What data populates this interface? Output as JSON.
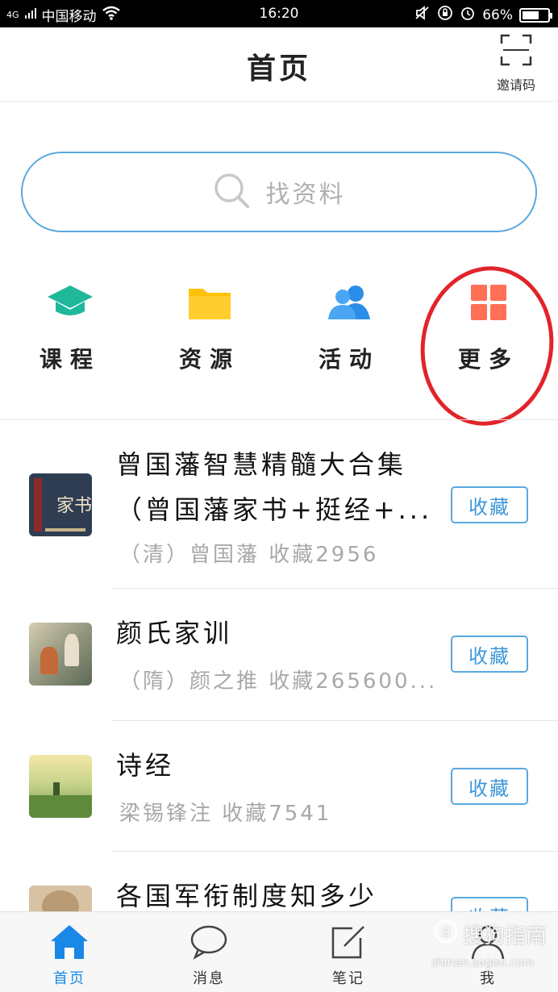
{
  "status_bar": {
    "network": "4G",
    "carrier": "中国移动",
    "time": "16:20",
    "battery": "66%",
    "battery_level": 0.66
  },
  "header": {
    "title": "首页",
    "invite_label": "邀请码"
  },
  "search": {
    "placeholder": "找资料"
  },
  "categories": [
    {
      "label": "课程",
      "icon": "graduation-cap-icon",
      "color": "#1fb89a"
    },
    {
      "label": "资源",
      "icon": "folder-icon",
      "color": "#ffc107"
    },
    {
      "label": "活动",
      "icon": "people-icon",
      "color": "#2a8ee8"
    },
    {
      "label": "更多",
      "icon": "grid-icon",
      "color": "#ff7057"
    }
  ],
  "books": [
    {
      "title_line1": "曾国藩智慧精髓大合集",
      "title_line2": "（曾国藩家书+挺经+...",
      "meta": "（清）曾国藩 收藏2956",
      "button": "收藏",
      "cover_text": "家书"
    },
    {
      "title_line1": "颜氏家训",
      "meta": "（隋）颜之推 收藏265600...",
      "button": "收藏"
    },
    {
      "title_line1": "诗经",
      "meta": "梁锡锋注 收藏7541",
      "button": "收藏"
    },
    {
      "title_line1": "各国军衔制度知多少",
      "button": "收藏"
    }
  ],
  "tabs": [
    {
      "label": "首页"
    },
    {
      "label": "消息"
    },
    {
      "label": "笔记"
    },
    {
      "label": "我"
    }
  ],
  "watermark": {
    "text": "搜狗指南",
    "url": "zhinan.sogou.com"
  },
  "colors": {
    "accent": "#1a88e6",
    "border_blue": "#5aa8e0",
    "annotation_red": "#e2232a"
  }
}
